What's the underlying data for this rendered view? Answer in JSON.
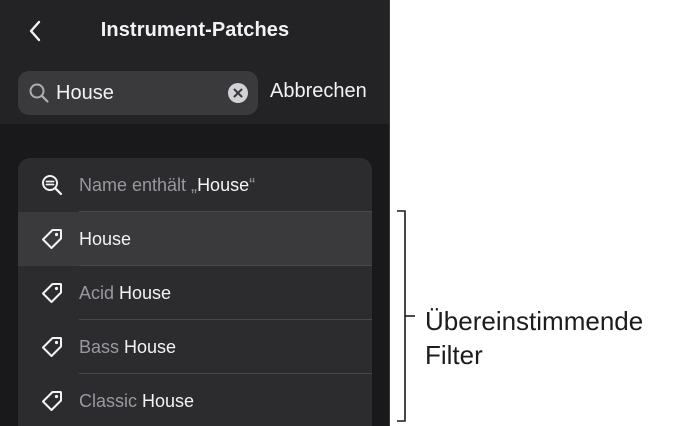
{
  "header": {
    "title": "Instrument-Patches",
    "back_icon": "chevron-left-icon"
  },
  "search": {
    "value": "House",
    "cancel_label": "Abbrechen"
  },
  "results": [
    {
      "kind": "name-filter",
      "icon": "magnifier-text-icon",
      "prefix": "Name enthält „",
      "match": "House",
      "suffix": "“"
    },
    {
      "kind": "tag",
      "icon": "tag-icon",
      "prefix": "",
      "match": "House",
      "selected": true
    },
    {
      "kind": "tag",
      "icon": "tag-icon",
      "prefix": "Acid ",
      "match": "House"
    },
    {
      "kind": "tag",
      "icon": "tag-icon",
      "prefix": "Bass ",
      "match": "House"
    },
    {
      "kind": "tag",
      "icon": "tag-icon",
      "prefix": "Classic ",
      "match": "House"
    }
  ],
  "annotation": {
    "line1": "Übereinstimmende",
    "line2": "Filter"
  },
  "colors": {
    "panel_bg": "#19191b",
    "header_bg": "#232325",
    "list_bg": "#2c2c2e",
    "selected_row": "#3a3a3c",
    "text": "#f2f2f7",
    "dim_text": "#98989f"
  }
}
